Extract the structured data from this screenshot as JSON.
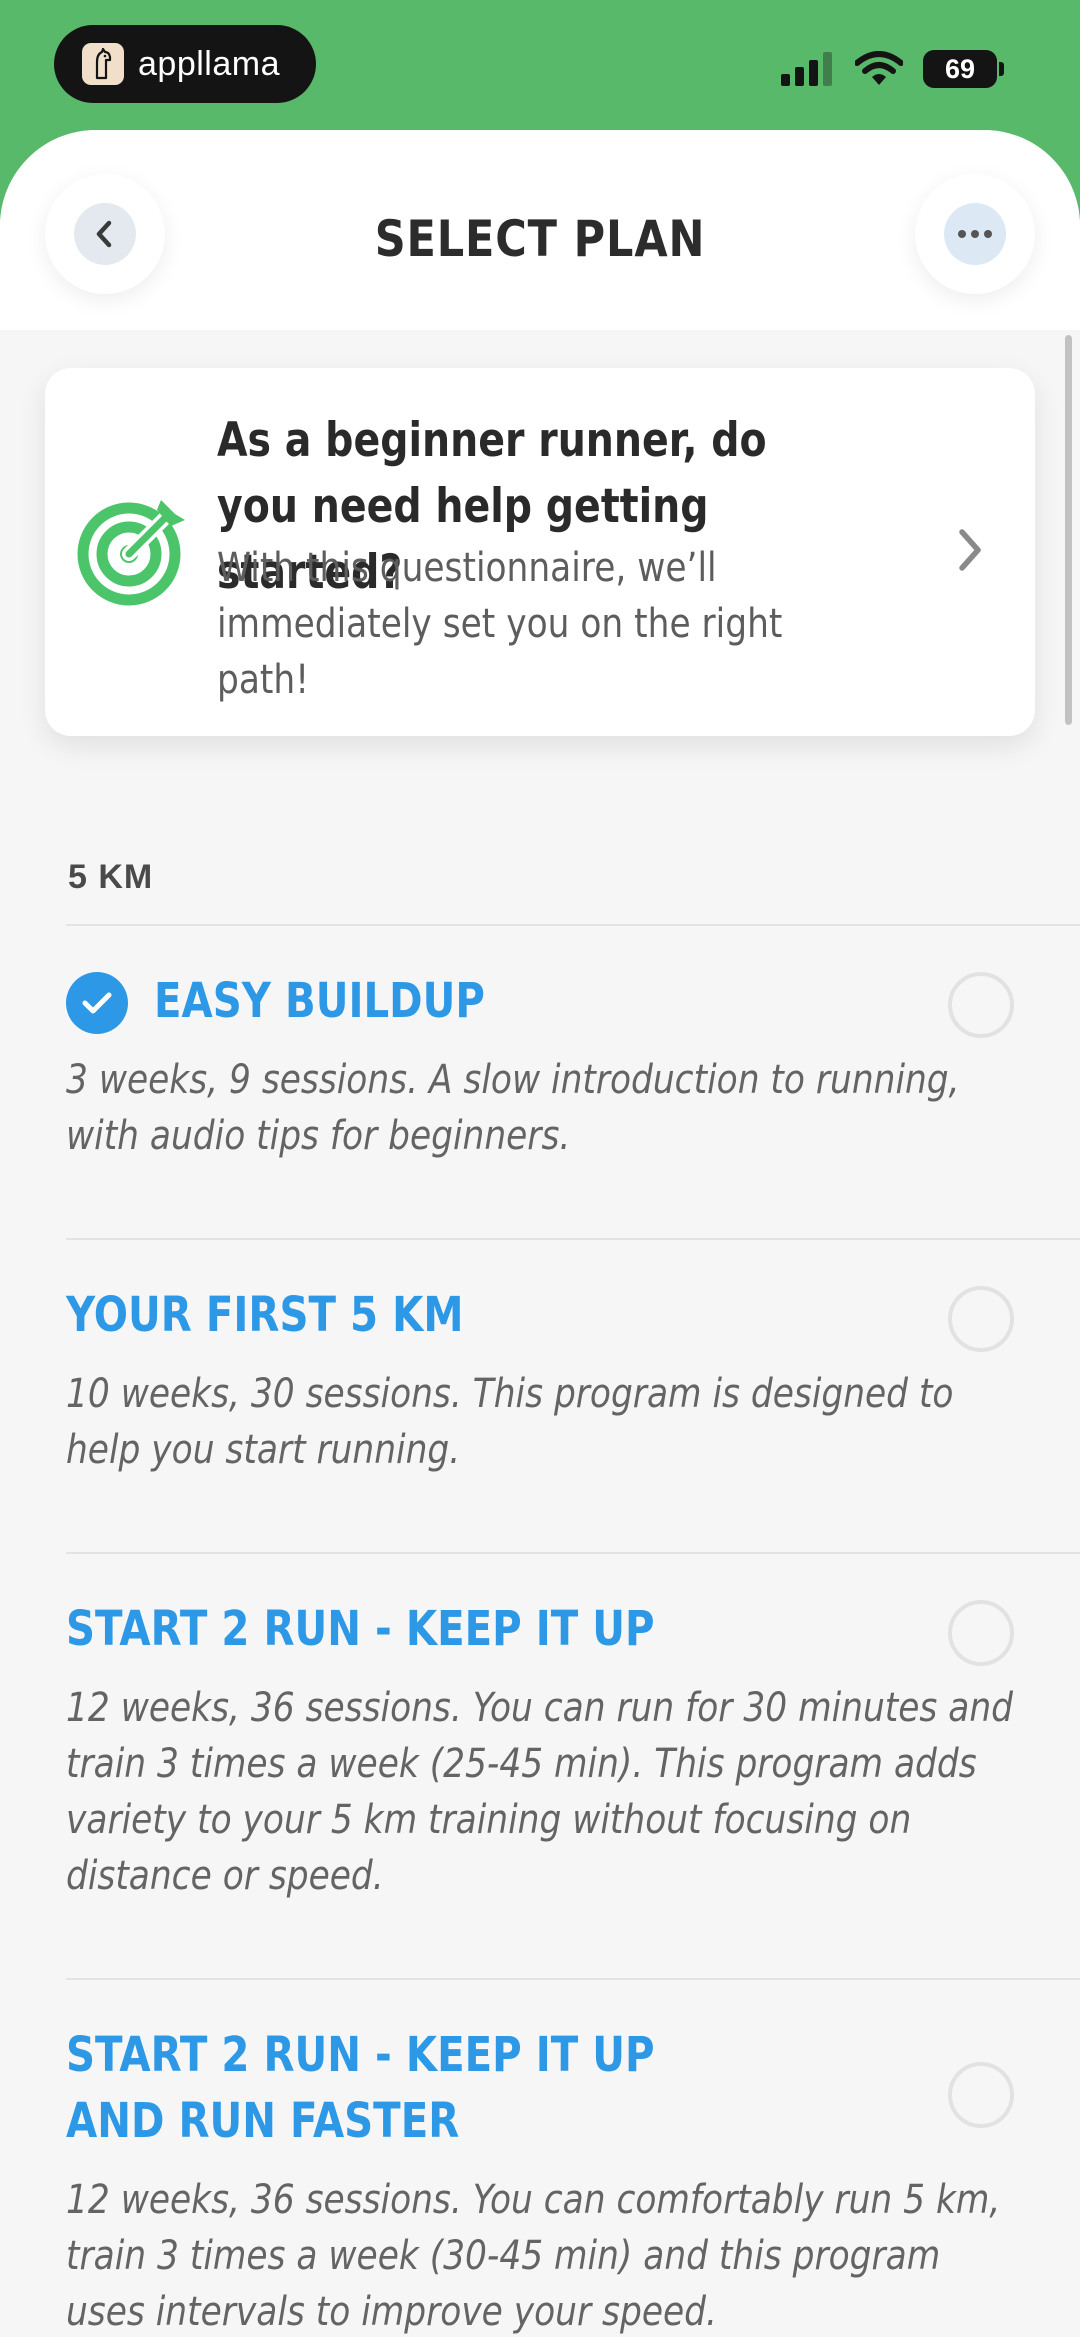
{
  "status_bar": {
    "brand_name": "appllama",
    "battery": "69",
    "icons": [
      "signal-icon",
      "wifi-icon",
      "battery-icon"
    ]
  },
  "header": {
    "title": "SELECT PLAN",
    "back_icon": "chevron-left-icon",
    "more_icon": "ellipsis-icon"
  },
  "promo": {
    "title": "As a beginner runner, do you need help getting started?",
    "text": "With this questionnaire, we’ll immediately set you on the right path!",
    "icon": "target-icon",
    "chevron": "chevron-right-icon"
  },
  "section": {
    "label": "5 KM"
  },
  "plans": [
    {
      "title": "EASY BUILDUP",
      "description": "3 weeks, 9 sessions. A slow introduction to running, with audio tips for beginners.",
      "selected": true
    },
    {
      "title": "YOUR FIRST 5 KM",
      "description": "10 weeks, 30 sessions. This program is designed to help you start running.",
      "selected": false
    },
    {
      "title": "START 2 RUN - KEEP IT UP",
      "description": "12 weeks, 36 sessions. You can run for 30 minutes and train 3 times a week (25-45 min). This program adds variety to your 5 km training without focusing on distance or speed.",
      "selected": false
    },
    {
      "title": "START 2 RUN - KEEP IT UP AND RUN FASTER",
      "description": "12 weeks, 36 sessions. You can comfortably run 5 km, train 3 times a week (30-45 min) and this program uses intervals to improve your speed.",
      "selected": false
    }
  ],
  "colors": {
    "brand_green": "#58b96a",
    "accent_blue": "#2d98e6",
    "target_green": "#4cc46a"
  }
}
